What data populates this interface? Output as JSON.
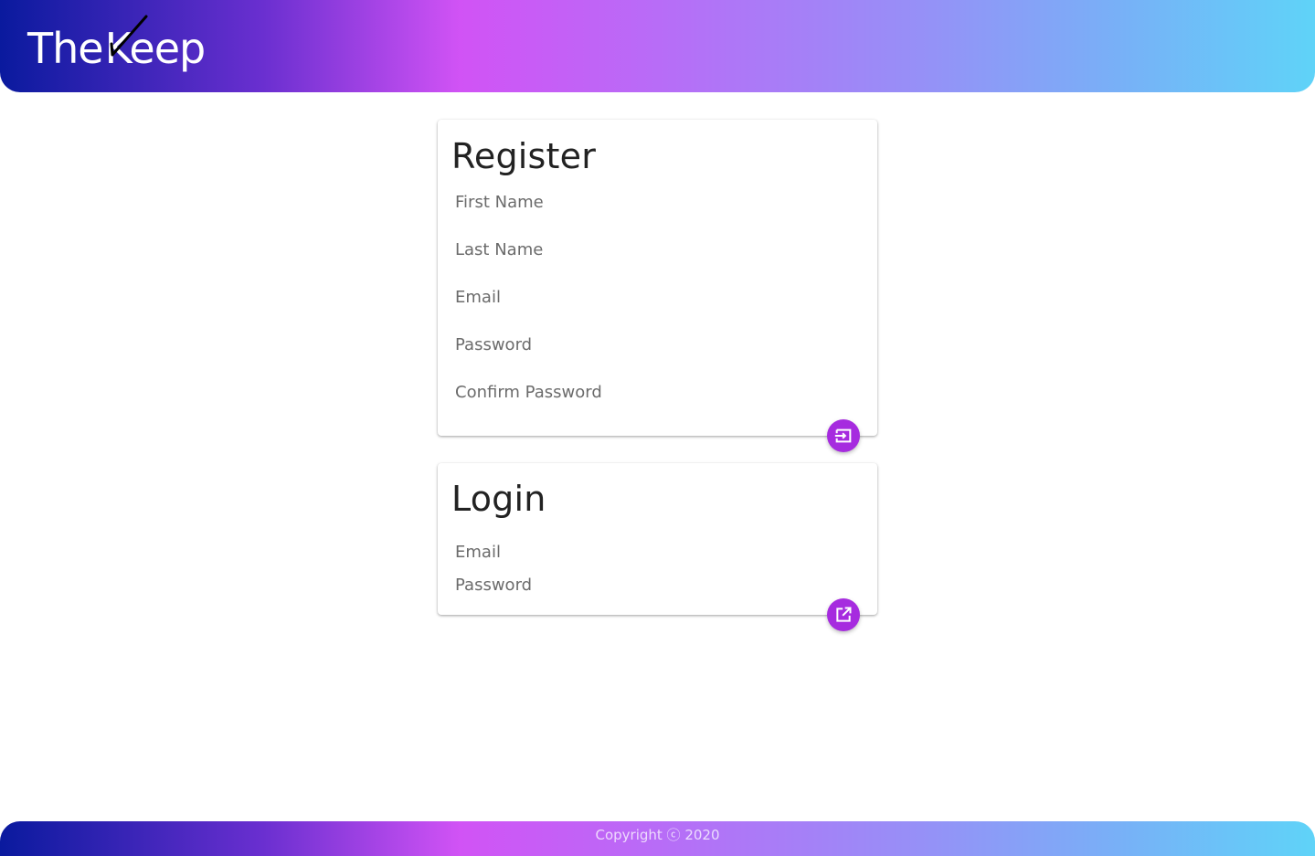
{
  "header": {
    "logo_the": "The",
    "logo_keep": "Keep",
    "logo_icon": "checkmark-icon"
  },
  "register": {
    "title": "Register",
    "fields": {
      "first_name": "First Name",
      "last_name": "Last Name",
      "email": "Email",
      "password": "Password",
      "confirm_password": "Confirm Password"
    },
    "submit_icon": "login-arrow-icon"
  },
  "login": {
    "title": "Login",
    "fields": {
      "email": "Email",
      "password": "Password"
    },
    "submit_icon": "open-in-new-icon"
  },
  "footer": {
    "copyright": "Copyright ⓒ 2020"
  },
  "colors": {
    "accent": "#a62bdf",
    "gradient_start": "#0a1a9e",
    "gradient_mid": "#d153f5",
    "gradient_end": "#5fd3f8"
  }
}
